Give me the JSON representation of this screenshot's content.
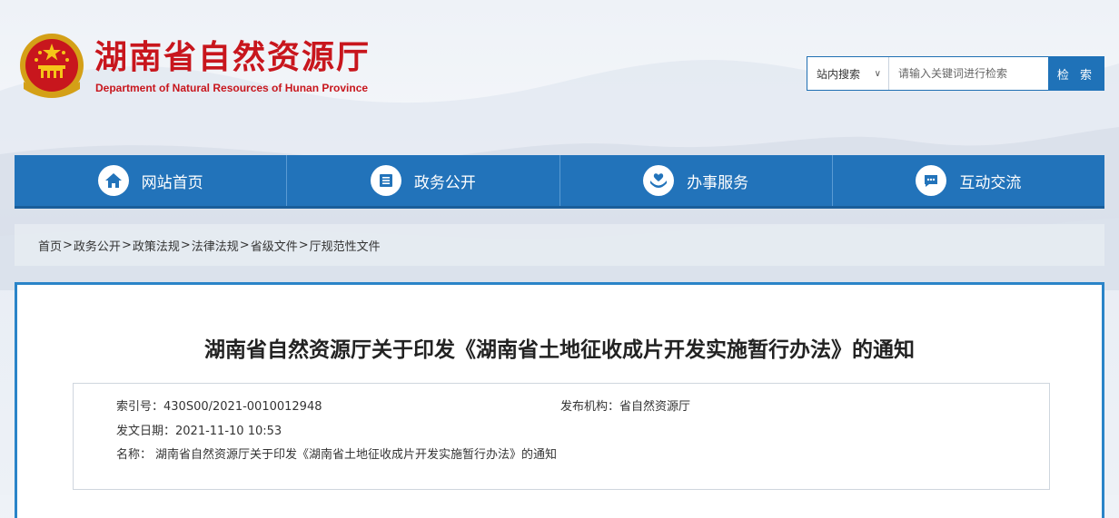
{
  "site": {
    "title": "湖南省自然资源厅",
    "subtitle": "Department of Natural Resources of Hunan Province"
  },
  "search": {
    "scope": "站内搜索",
    "placeholder": "请输入关键词进行检索",
    "button": "检 索"
  },
  "nav": [
    {
      "label": "网站首页",
      "icon": "home-icon"
    },
    {
      "label": "政务公开",
      "icon": "document-icon"
    },
    {
      "label": "办事服务",
      "icon": "service-hands-icon"
    },
    {
      "label": "互动交流",
      "icon": "chat-icon"
    }
  ],
  "breadcrumb": [
    "首页",
    "政务公开",
    "政策法规",
    "法律法规",
    "省级文件",
    "厅规范性文件"
  ],
  "article": {
    "title": "湖南省自然资源厅关于印发《湖南省土地征收成片开发实施暂行办法》的通知",
    "index_label": "索引号：",
    "index_value": "430S00/2021-0010012948",
    "publisher_label": "发布机构：",
    "publisher_value": "省自然资源厅",
    "date_label": "发文日期：",
    "date_value": "2021-11-10 10:53",
    "name_label": "名称：",
    "name_value": "湖南省自然资源厅关于印发《湖南省土地征收成片开发实施暂行办法》的通知"
  },
  "colors": {
    "brand_red": "#c8161d",
    "nav_blue": "#2273ba",
    "border_blue": "#2a84c8"
  }
}
